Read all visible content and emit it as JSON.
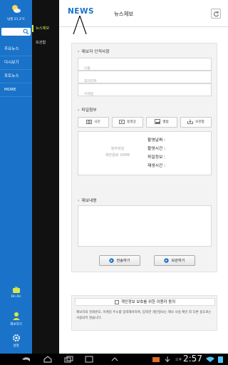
{
  "sidebar": {
    "weather_text": "남원 21.2℃",
    "search_placeholder": "",
    "items": [
      {
        "label": "주요뉴스"
      },
      {
        "label": "다시보기"
      },
      {
        "label": "포토뉴스"
      },
      {
        "label": "MORE"
      }
    ],
    "on_air_label": "On Air",
    "report_label": "제보하기",
    "settings_label": "설정"
  },
  "submenu": {
    "items": [
      {
        "label": "뉴스제보",
        "active": true
      },
      {
        "label": "보관함",
        "active": false
      }
    ]
  },
  "header": {
    "logo_text": "NEWS",
    "title": "뉴스제보"
  },
  "form": {
    "reporter_section_title": "제보자 인적사항",
    "name_placeholder": "이름",
    "phone_placeholder": "휴대전화",
    "email_placeholder": "이메일",
    "attach_section_title": "파일첨부",
    "attach_buttons": [
      {
        "label": "사진",
        "icon": "camera-icon"
      },
      {
        "label": "동영상",
        "icon": "video-icon"
      },
      {
        "label": "앨범",
        "icon": "album-icon"
      },
      {
        "label": "보관함",
        "icon": "archive-icon"
      }
    ],
    "attach_limit_line1": "첨부파일",
    "attach_limit_line2": "제한용량 30MB",
    "meta_date": "촬영날짜 :",
    "meta_time": "촬영시간 :",
    "meta_fileinfo": "파일정보 :",
    "meta_playtime": "재생시간 :",
    "content_section_title": "제보내용",
    "send_button": "전송하기",
    "save_button": "보관하기"
  },
  "privacy": {
    "title": "개인정보 보호를 위한 이용자 동의",
    "body": "제보자의 전화번호, 이메일 주소를 입력해야하여, 입력한 개인정보는 제보 사실 확인 외 다른 용도로는 사용되지 않습니다."
  },
  "statusbar": {
    "ampm": "오후",
    "time": "2:57"
  },
  "colors": {
    "sidebar_blue": "#1a73c9",
    "submenu_dark": "#111111",
    "active_accent": "#d6e84a"
  }
}
